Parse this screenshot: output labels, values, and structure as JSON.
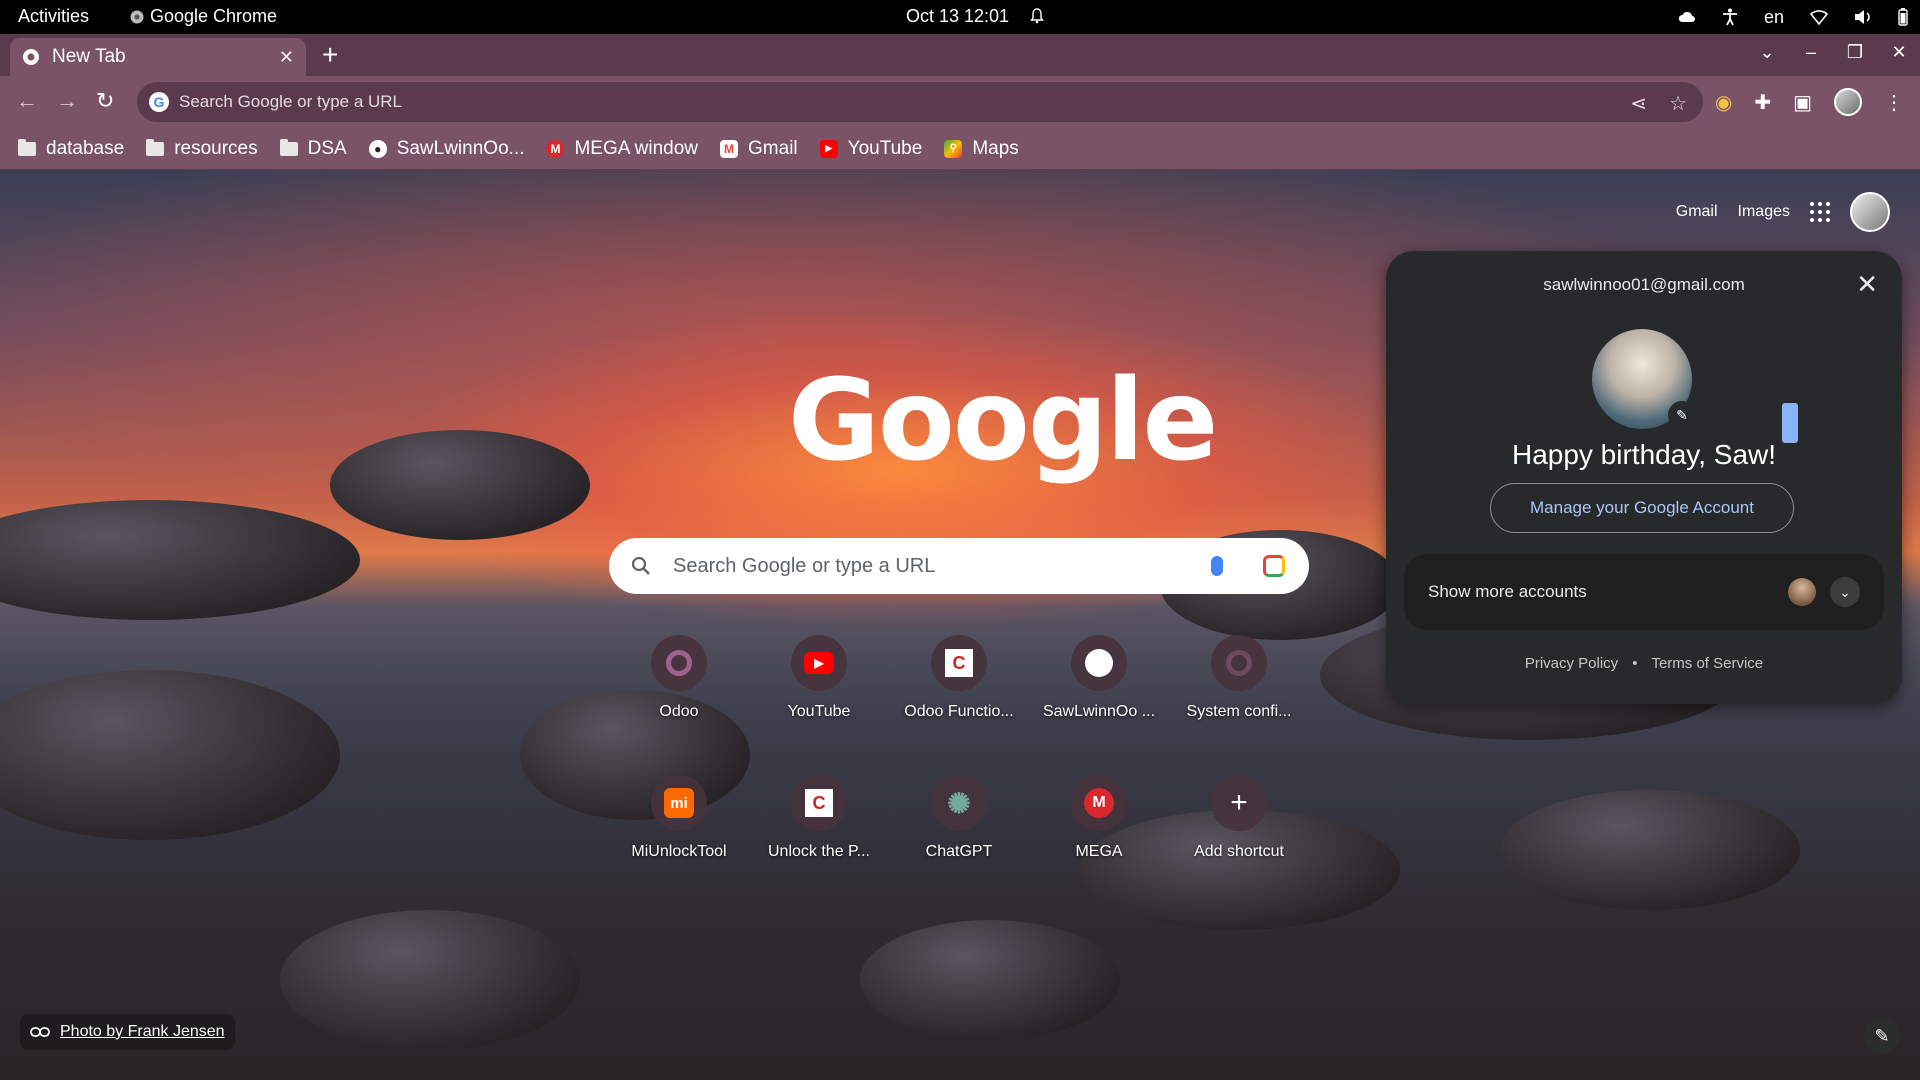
{
  "system_bar": {
    "activities": "Activities",
    "app_name": "Google Chrome",
    "datetime": "Oct 13  12:01",
    "language": "en"
  },
  "tabs": [
    {
      "title": "New Tab"
    }
  ],
  "omnibox": {
    "placeholder": "Search Google or type a URL"
  },
  "bookmarks": [
    {
      "label": "database",
      "icon": "folder-icon"
    },
    {
      "label": "resources",
      "icon": "folder-icon"
    },
    {
      "label": "DSA",
      "icon": "folder-icon"
    },
    {
      "label": "SawLwinnOo...",
      "icon": "github-icon"
    },
    {
      "label": "MEGA window",
      "icon": "mega-icon"
    },
    {
      "label": "Gmail",
      "icon": "gmail-icon"
    },
    {
      "label": "YouTube",
      "icon": "youtube-icon"
    },
    {
      "label": "Maps",
      "icon": "maps-icon"
    }
  ],
  "ntp": {
    "links": {
      "gmail": "Gmail",
      "images": "Images"
    },
    "logo": "Google",
    "search_placeholder": "Search Google or type a URL",
    "shortcuts": [
      {
        "label": "Odoo",
        "icon": "odoo-icon"
      },
      {
        "label": "YouTube",
        "icon": "youtube-icon"
      },
      {
        "label": "Odoo Functio...",
        "icon": "odoo-functions-icon"
      },
      {
        "label": "SawLwinnOo ...",
        "icon": "github-icon"
      },
      {
        "label": "System confi...",
        "icon": "odoo-icon"
      },
      {
        "label": "MiUnlockTool",
        "icon": "mi-icon"
      },
      {
        "label": "Unlock the P...",
        "icon": "unlock-icon"
      },
      {
        "label": "ChatGPT",
        "icon": "chatgpt-icon"
      },
      {
        "label": "MEGA",
        "icon": "mega-icon"
      },
      {
        "label": "Add shortcut",
        "icon": "plus-icon"
      }
    ],
    "photo_credit": "Photo by Frank Jensen"
  },
  "account_popup": {
    "email": "sawlwinnoo01@gmail.com",
    "greeting": "Happy birthday, Saw!",
    "manage_label": "Manage your Google Account",
    "show_more_label": "Show more accounts",
    "privacy": "Privacy Policy",
    "separator": "•",
    "terms": "Terms of Service"
  },
  "colors": {
    "frame": "#5b3a4e",
    "toolbar": "#7a5367",
    "popup_bg": "#28292a",
    "link_blue": "#a8c7fa"
  }
}
